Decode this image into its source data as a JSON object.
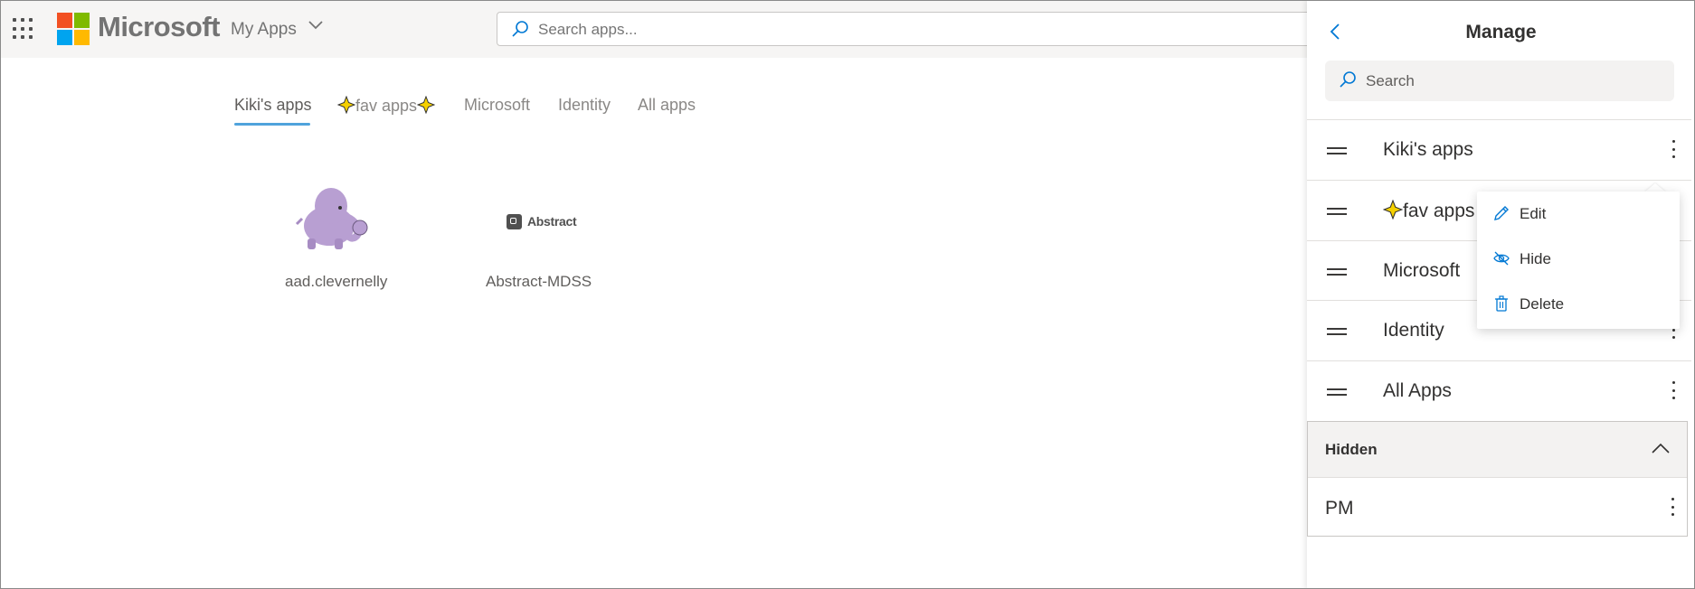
{
  "header": {
    "brand": "Microsoft",
    "app_switcher_label": "My Apps",
    "search_placeholder": "Search apps..."
  },
  "tabs": [
    {
      "label": "Kiki's apps",
      "active": true
    },
    {
      "label": "fav apps",
      "decoration": "sparkle-star-icon"
    },
    {
      "label": "Microsoft"
    },
    {
      "label": "Identity"
    },
    {
      "label": "All apps"
    }
  ],
  "apps": [
    {
      "name": "aad.clevernelly",
      "icon": "elephant-icon"
    },
    {
      "name": "Abstract-MDSS",
      "icon": "abstract-logo",
      "logo_text": "Abstract"
    }
  ],
  "manage_panel": {
    "title": "Manage",
    "search_placeholder": "Search",
    "collections": [
      {
        "label": "Kiki's apps"
      },
      {
        "label": "fav apps",
        "decoration": "sparkle-star-icon"
      },
      {
        "label": "Microsoft"
      },
      {
        "label": "Identity"
      },
      {
        "label": "All Apps"
      }
    ],
    "hidden_section": {
      "title": "Hidden",
      "items": [
        {
          "label": "PM"
        }
      ]
    }
  },
  "context_menu": {
    "items": [
      {
        "label": "Edit",
        "icon": "pencil-icon"
      },
      {
        "label": "Hide",
        "icon": "eye-off-icon"
      },
      {
        "label": "Delete",
        "icon": "trash-icon"
      }
    ]
  },
  "colors": {
    "accent": "#4fa3dc",
    "ms_red": "#f25022",
    "ms_green": "#7fba00",
    "ms_blue": "#00a4ef",
    "ms_yellow": "#ffb900"
  }
}
